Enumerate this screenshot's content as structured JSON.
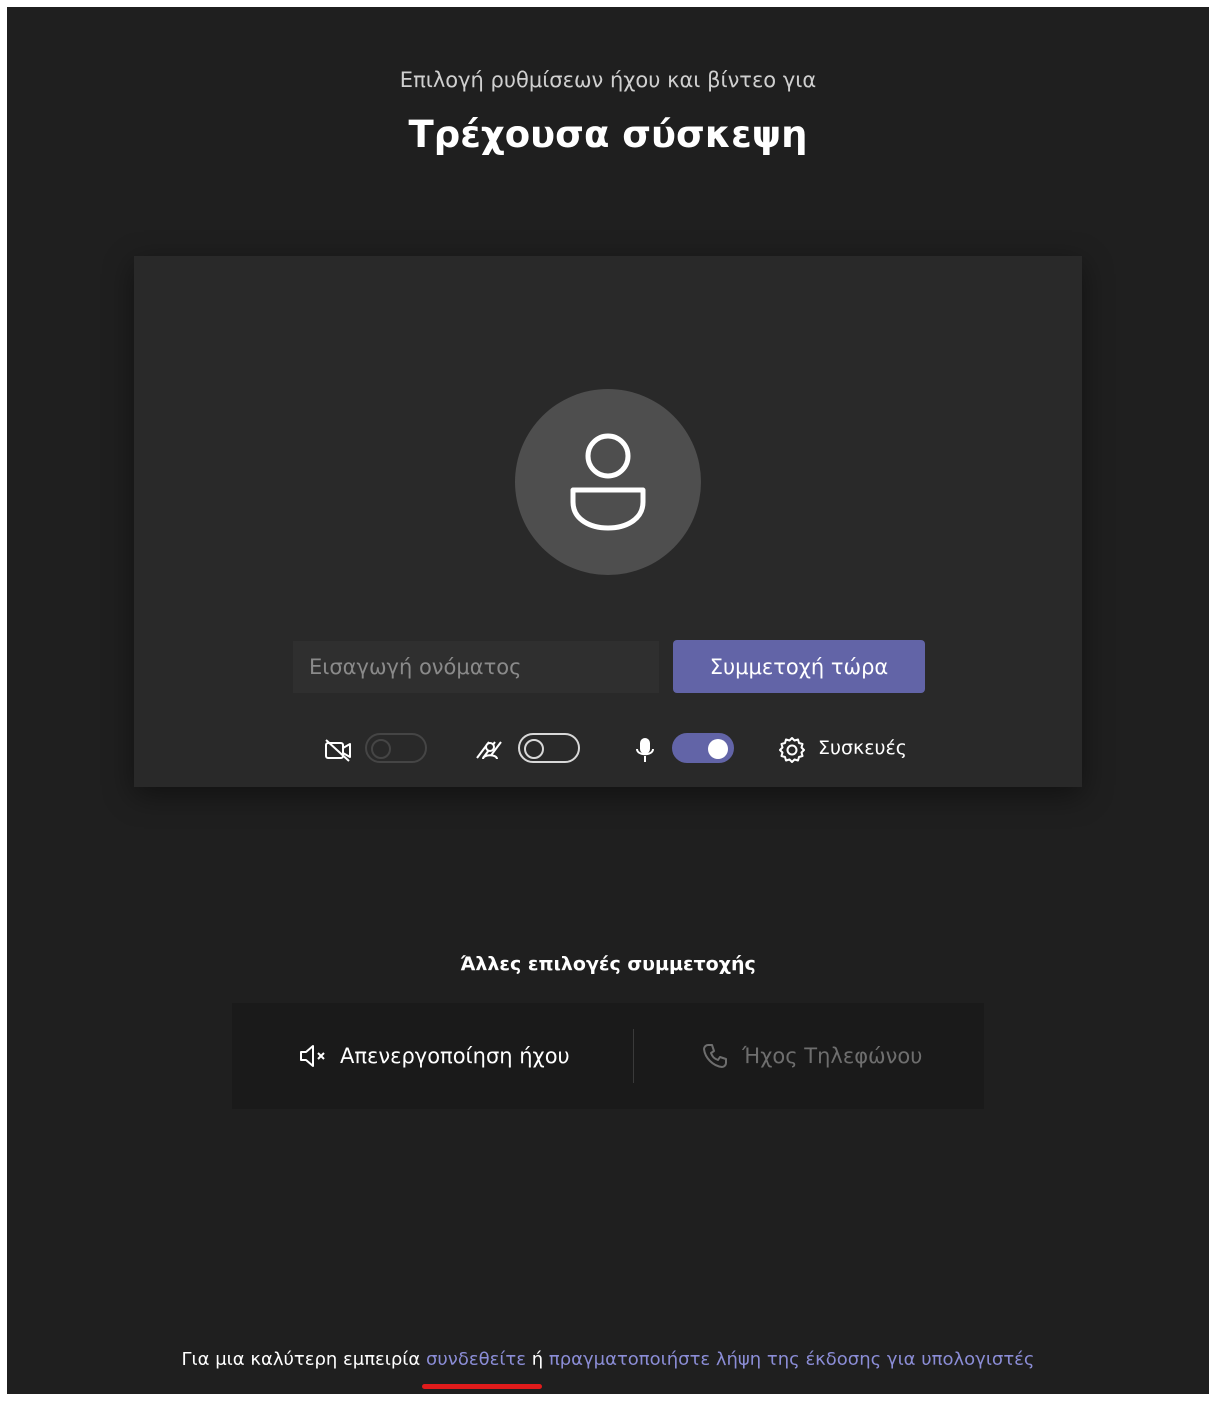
{
  "header": {
    "subtitle": "Επιλογή ρυθμίσεων ήχου και βίντεο για",
    "title": "Τρέχουσα σύσκεψη"
  },
  "prejoin": {
    "name_placeholder": "Εισαγωγή ονόματος",
    "join_label": "Συμμετοχή τώρα",
    "camera_toggle": "off-disabled",
    "background_toggle": "off",
    "mic_toggle": "on",
    "devices_label": "Συσκευές",
    "icons": [
      "avatar-person-icon",
      "camera-off-icon",
      "background-effects-icon",
      "microphone-icon",
      "gear-icon"
    ]
  },
  "other_options": {
    "title": "Άλλες επιλογές συμμετοχής",
    "mute_label": "Απενεργοποίηση ήχου",
    "phone_label": "Ήχος Τηλεφώνου",
    "icons": [
      "speaker-mute-icon",
      "phone-icon"
    ]
  },
  "footer": {
    "prefix": "Για μια καλύτερη εμπειρία ",
    "signin_link": "συνδεθείτε",
    "middle": " ή ",
    "download_link": "πραγματοποιήστε λήψη της έκδοσης για υπολογιστές"
  },
  "colors": {
    "background": "#1f1f1f",
    "panel": "#292929",
    "accent": "#6264a7",
    "link": "#8b8dd6",
    "annotation": "#e01b1b"
  }
}
